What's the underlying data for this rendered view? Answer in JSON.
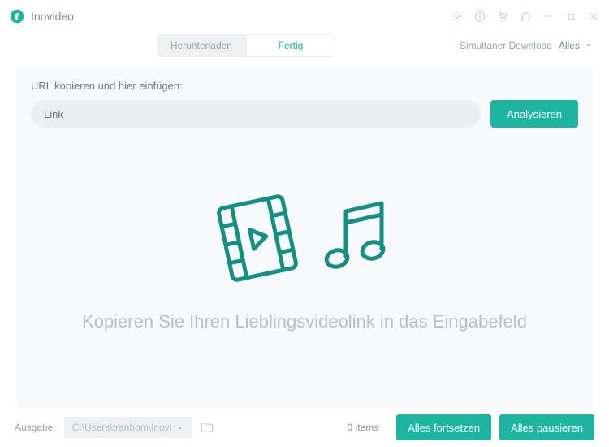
{
  "app": {
    "title": "Inovideo"
  },
  "tabs": {
    "download": "Herunterladen",
    "done": "Fertig"
  },
  "rightControls": {
    "simultaneous": "Simultaner Download",
    "filter": "Alles"
  },
  "panel": {
    "label": "URL kopieren und hier einfügen:",
    "placeholder": "Link",
    "analyze": "Analysieren"
  },
  "empty": {
    "message": "Kopieren Sie Ihren Lieblingsvideolink in das Eingabefeld"
  },
  "footer": {
    "outputLabel": "Ausgabe:",
    "path": "C:\\Users\\tranhom\\Inovi",
    "items": "0 items",
    "resumeAll": "Alles fortsetzen",
    "pauseAll": "Alles pausieren"
  }
}
